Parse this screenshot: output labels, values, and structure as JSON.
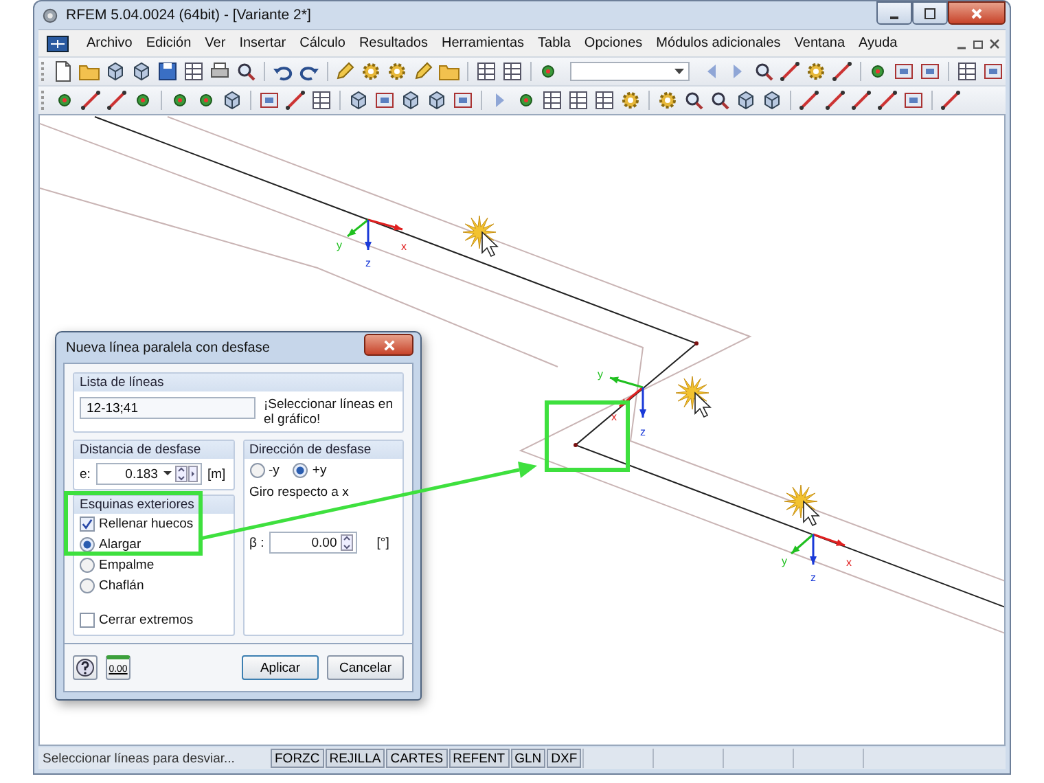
{
  "window": {
    "title": "RFEM 5.04.0024 (64bit) - [Variante 2*]"
  },
  "menu": [
    "Archivo",
    "Edición",
    "Ver",
    "Insertar",
    "Cálculo",
    "Resultados",
    "Herramientas",
    "Tabla",
    "Opciones",
    "Módulos adicionales",
    "Ventana",
    "Ayuda"
  ],
  "canvas": {
    "axes": [
      {
        "x": "x",
        "y": "y",
        "z": "z"
      },
      {
        "x": "x",
        "y": "y",
        "z": "z"
      },
      {
        "x": "x",
        "y": "y",
        "z": "z"
      }
    ]
  },
  "dialog": {
    "title": "Nueva línea paralela con desfase",
    "lines_list": {
      "label": "Lista de líneas",
      "value": "12-13;41",
      "hint": "¡Seleccionar líneas en el gráfico!"
    },
    "offset_distance": {
      "label": "Distancia de desfase",
      "symbol": "e:",
      "value": "0.183",
      "unit": "[m]"
    },
    "offset_direction": {
      "label": "Dirección de desfase",
      "options": [
        {
          "label": "-y",
          "selected": false
        },
        {
          "label": "+y",
          "selected": true
        }
      ]
    },
    "rotation": {
      "label": "Giro respecto a x",
      "symbol": "β :",
      "value": "0.00",
      "unit": "[°]"
    },
    "outer_corners": {
      "label": "Esquinas exteriores",
      "fill_gaps": {
        "label": "Rellenar huecos",
        "checked": true
      },
      "options": [
        {
          "label": "Alargar",
          "selected": true
        },
        {
          "label": "Empalme",
          "selected": false
        },
        {
          "label": "Chaflán",
          "selected": false
        }
      ]
    },
    "close_ends": {
      "label": "Cerrar extremos",
      "checked": false
    },
    "units_button": "0.00",
    "buttons": [
      "Aplicar",
      "Cancelar"
    ]
  },
  "status_bar": {
    "message": "Seleccionar líneas para desviar...",
    "toggles": [
      "FORZC",
      "REJILLA",
      "CARTES",
      "REFENT",
      "GLN",
      "DXF"
    ]
  }
}
